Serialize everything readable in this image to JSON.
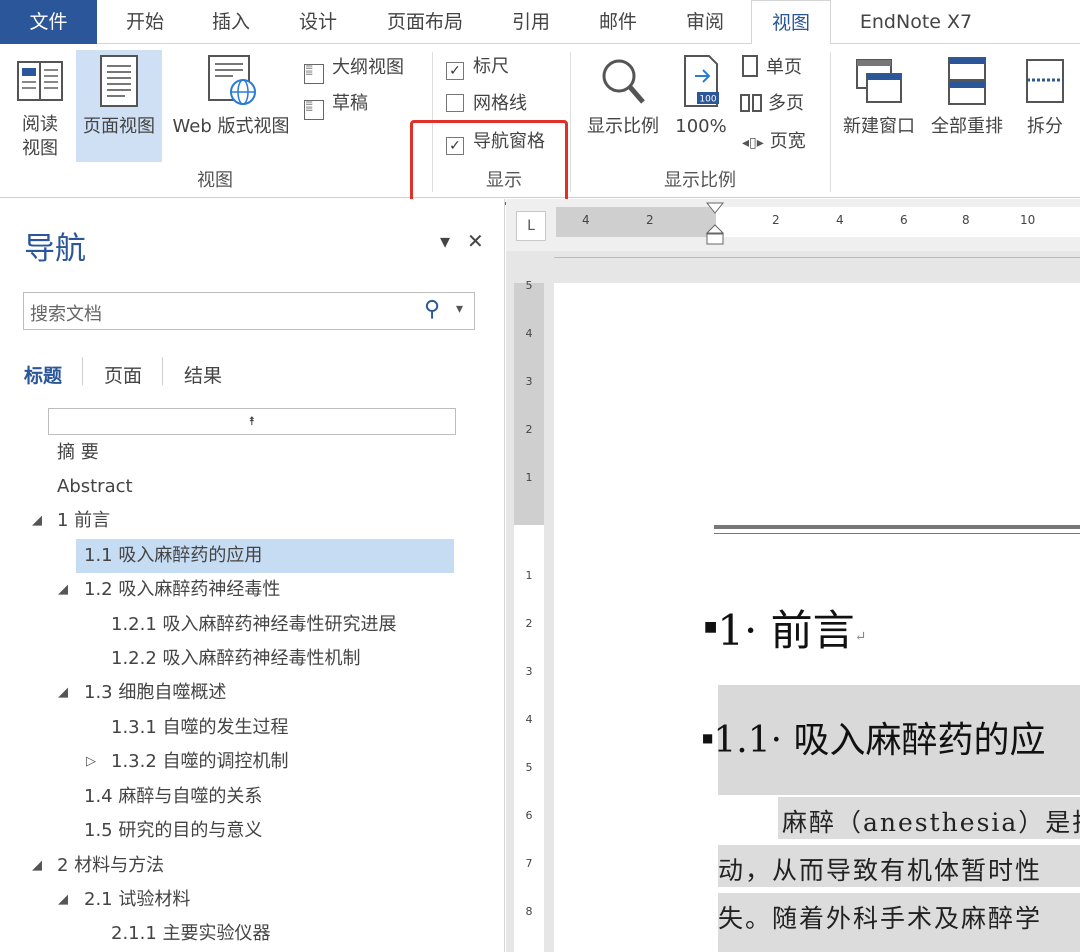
{
  "tabs": {
    "file": "文件",
    "home": "开始",
    "insert": "插入",
    "design": "设计",
    "layout": "页面布局",
    "references": "引用",
    "mailings": "邮件",
    "review": "审阅",
    "view": "视图",
    "endnote": "EndNote X7"
  },
  "ribbon": {
    "views": {
      "read_line1": "阅读",
      "read_line2": "视图",
      "print_layout": "页面视图",
      "web_layout": "Web 版式视图",
      "outline": "大纲视图",
      "draft": "草稿",
      "group_label": "视图"
    },
    "show": {
      "ruler": "标尺",
      "ruler_checked": "✓",
      "gridlines": "网格线",
      "gridlines_checked": "",
      "nav_pane": "导航窗格",
      "nav_pane_checked": "✓",
      "group_label": "显示"
    },
    "zoom": {
      "zoom": "显示比例",
      "hundred": "100%",
      "one_page": "单页",
      "multi_page": "多页",
      "page_width": "页宽",
      "group_label": "显示比例"
    },
    "window": {
      "new_window": "新建窗口",
      "arrange_all": "全部重排",
      "split": "拆分"
    }
  },
  "nav": {
    "title": "导航",
    "dropdown_icon": "▾",
    "close_icon": "✕",
    "search_placeholder": "搜索文档",
    "search_icon": "⚲",
    "search_dropdown": "▾",
    "subtabs": {
      "headings": "标题",
      "pages": "页面",
      "results": "结果"
    },
    "collapse_icon": "⯭",
    "items": [
      {
        "label": "摘  要"
      },
      {
        "label": "Abstract"
      },
      {
        "label": "1 前言",
        "arrow": "◢"
      },
      {
        "label": "1.1 吸入麻醉药的应用"
      },
      {
        "label": "1.2 吸入麻醉药神经毒性",
        "arrow": "◢"
      },
      {
        "label": "1.2.1 吸入麻醉药神经毒性研究进展"
      },
      {
        "label": "1.2.2 吸入麻醉药神经毒性机制"
      },
      {
        "label": "1.3 细胞自噬概述",
        "arrow": "◢"
      },
      {
        "label": "1.3.1 自噬的发生过程"
      },
      {
        "label": "1.3.2 自噬的调控机制",
        "arrow": "▷"
      },
      {
        "label": "1.4 麻醉与自噬的关系"
      },
      {
        "label": "1.5 研究的目的与意义"
      },
      {
        "label": "2 材料与方法",
        "arrow": "◢"
      },
      {
        "label": "2.1 试验材料",
        "arrow": "◢"
      },
      {
        "label": "2.1.1 主要实验仪器"
      }
    ]
  },
  "ruler": {
    "corner": "L",
    "h_ticks": [
      "4",
      "2",
      "2",
      "4",
      "6",
      "8",
      "10"
    ],
    "v_ticks": [
      "5",
      "4",
      "3",
      "2",
      "1",
      "1",
      "2",
      "3",
      "4",
      "5",
      "6",
      "7",
      "8"
    ]
  },
  "document": {
    "heading1": "1· 前言",
    "heading2": "1.1· 吸入麻醉药的应",
    "para_line1": "麻醉（anesthesia）是指",
    "para_line2": "动，从而导致有机体暂时性",
    "para_line3": "失。随着外科手术及麻醉学",
    "para_mark": "↵"
  }
}
